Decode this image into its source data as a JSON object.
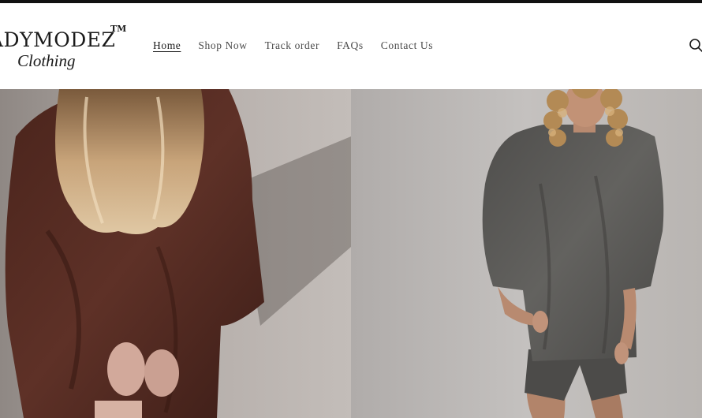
{
  "brand": {
    "logo_main": "ADYMODEZ",
    "logo_tm": "TM",
    "logo_sub": "Clothing"
  },
  "nav": {
    "items": [
      {
        "label": "Home",
        "active": true
      },
      {
        "label": "Shop Now",
        "active": false
      },
      {
        "label": "Track order",
        "active": false
      },
      {
        "label": "FAQs",
        "active": false
      },
      {
        "label": "Contact Us",
        "active": false
      }
    ]
  },
  "header": {
    "search_icon": "search-icon"
  },
  "hero": {
    "left_image": "model-brown-oversized-tee-image",
    "right_image": "model-grey-oversized-tee-image"
  },
  "colors": {
    "topbar": "#111111",
    "text": "#1a1a1a",
    "nav_text": "#4a4a4a",
    "brown_garment": "#5a2f26",
    "grey_garment": "#5b5a58"
  }
}
